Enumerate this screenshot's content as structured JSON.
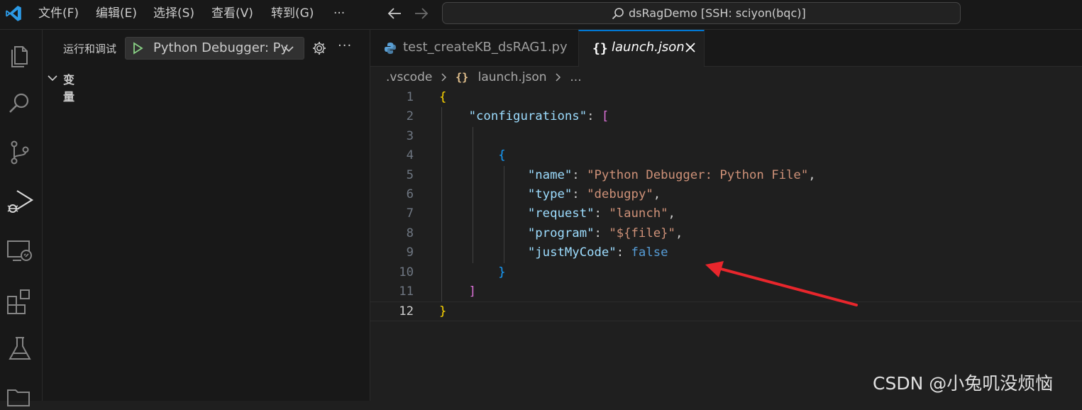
{
  "menu": [
    "文件(F)",
    "编辑(E)",
    "选择(S)",
    "查看(V)",
    "转到(G)",
    "···"
  ],
  "command_center": "dsRagDemo [SSH: sciyon(bqc)]",
  "sidebar": {
    "title": "运行和调试",
    "config_select": "Python Debugger: Py",
    "more": "···",
    "section": "变量"
  },
  "tabs": [
    {
      "label": "test_createKB_dsRAG1.py",
      "active": false
    },
    {
      "label": "launch.json",
      "active": true
    }
  ],
  "breadcrumb": {
    "folder": ".vscode",
    "braces": "{}",
    "file": "launch.json",
    "more": "..."
  },
  "editor": {
    "current_line": 12,
    "line_numbers": [
      "1",
      "2",
      "3",
      "4",
      "5",
      "6",
      "7",
      "8",
      "9",
      "10",
      "11",
      "12"
    ],
    "lines": [
      [
        {
          "t": "{",
          "c": "p-b1"
        }
      ],
      [
        {
          "t": "    "
        },
        {
          "t": "\"configurations\"",
          "c": "key"
        },
        {
          "t": ": ",
          "c": "pun"
        },
        {
          "t": "[",
          "c": "p-b2"
        }
      ],
      [
        {
          "t": ""
        }
      ],
      [
        {
          "t": "        "
        },
        {
          "t": "{",
          "c": "p-b3"
        }
      ],
      [
        {
          "t": "            "
        },
        {
          "t": "\"name\"",
          "c": "key"
        },
        {
          "t": ": ",
          "c": "pun"
        },
        {
          "t": "\"Python Debugger: Python File\"",
          "c": "str"
        },
        {
          "t": ",",
          "c": "pun"
        }
      ],
      [
        {
          "t": "            "
        },
        {
          "t": "\"type\"",
          "c": "key"
        },
        {
          "t": ": ",
          "c": "pun"
        },
        {
          "t": "\"debugpy\"",
          "c": "str"
        },
        {
          "t": ",",
          "c": "pun"
        }
      ],
      [
        {
          "t": "            "
        },
        {
          "t": "\"request\"",
          "c": "key"
        },
        {
          "t": ": ",
          "c": "pun"
        },
        {
          "t": "\"launch\"",
          "c": "str"
        },
        {
          "t": ",",
          "c": "pun"
        }
      ],
      [
        {
          "t": "            "
        },
        {
          "t": "\"program\"",
          "c": "key"
        },
        {
          "t": ": ",
          "c": "pun"
        },
        {
          "t": "\"${file}\"",
          "c": "str"
        },
        {
          "t": ",",
          "c": "pun"
        }
      ],
      [
        {
          "t": "            "
        },
        {
          "t": "\"justMyCode\"",
          "c": "key"
        },
        {
          "t": ": ",
          "c": "pun"
        },
        {
          "t": "false",
          "c": "kw"
        }
      ],
      [
        {
          "t": "        "
        },
        {
          "t": "}",
          "c": "p-b3"
        }
      ],
      [
        {
          "t": "    "
        },
        {
          "t": "]",
          "c": "p-b2"
        }
      ],
      [
        {
          "t": "}",
          "c": "p-b1"
        }
      ]
    ]
  },
  "watermark": "CSDN @小兔叽没烦恼",
  "colors": {
    "accent": "#0078d4",
    "annotation_arrow": "#e8262c",
    "debug_green": "#89d185"
  }
}
